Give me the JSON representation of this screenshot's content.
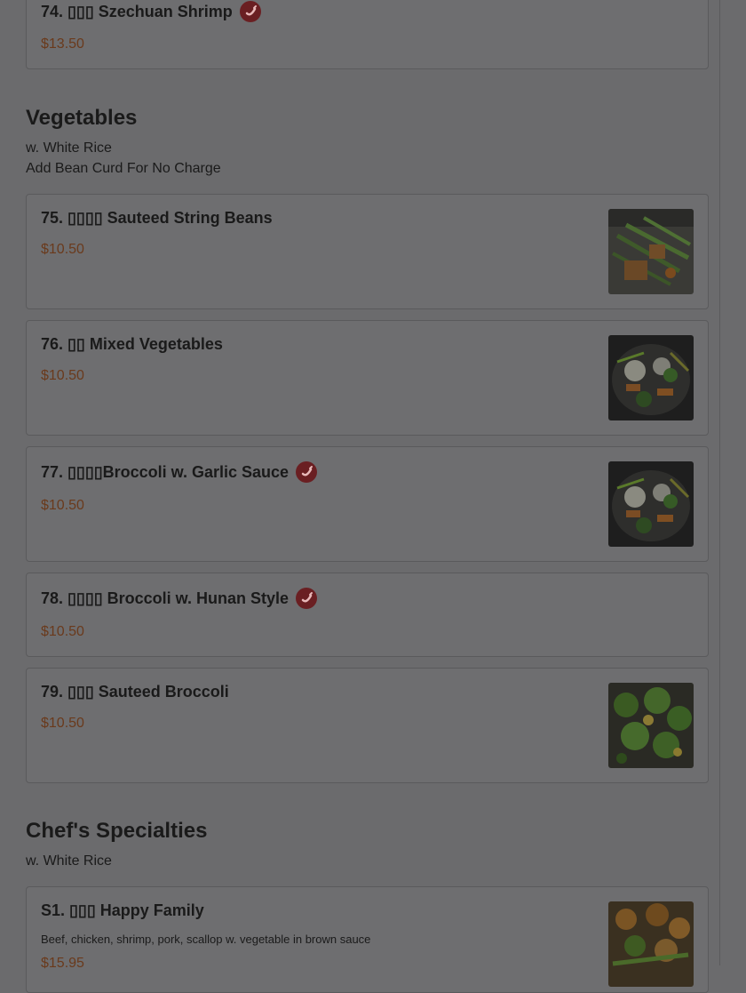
{
  "sections": {
    "vegetables": {
      "title": "Vegetables",
      "notes": [
        "w. White Rice",
        "Add Bean Curd For No Charge"
      ]
    },
    "chefs_specialties": {
      "title": "Chef's Specialties",
      "notes": [
        "w. White Rice"
      ]
    }
  },
  "items": {
    "i74": {
      "title": "74. ▯▯▯ Szechuan Shrimp",
      "price": "$13.50",
      "spicy": true
    },
    "i75": {
      "title": "75. ▯▯▯▯ Sauteed String Beans",
      "price": "$10.50",
      "image": "string-beans-photo"
    },
    "i76": {
      "title": "76. ▯▯ Mixed Vegetables",
      "price": "$10.50",
      "image": "mixed-vegetables-photo"
    },
    "i77": {
      "title": "77. ▯▯▯▯Broccoli w. Garlic Sauce",
      "price": "$10.50",
      "spicy": true,
      "image": "broccoli-garlic-photo"
    },
    "i78": {
      "title": "78. ▯▯▯▯ Broccoli w. Hunan Style",
      "price": "$10.50",
      "spicy": true
    },
    "i79": {
      "title": "79. ▯▯▯ Sauteed Broccoli",
      "price": "$10.50",
      "image": "sauteed-broccoli-photo"
    },
    "s1": {
      "title": "S1. ▯▯▯ Happy Family",
      "description": "Beef, chicken, shrimp, pork, scallop w. vegetable in brown sauce",
      "price": "$15.95",
      "image": "happy-family-photo"
    }
  },
  "icons": {
    "spicy": "chili-pepper-icon"
  },
  "colors": {
    "overlay": "#6b6b6d",
    "price": "#6a3a1c",
    "spicy_badge": "#6a1f22"
  }
}
